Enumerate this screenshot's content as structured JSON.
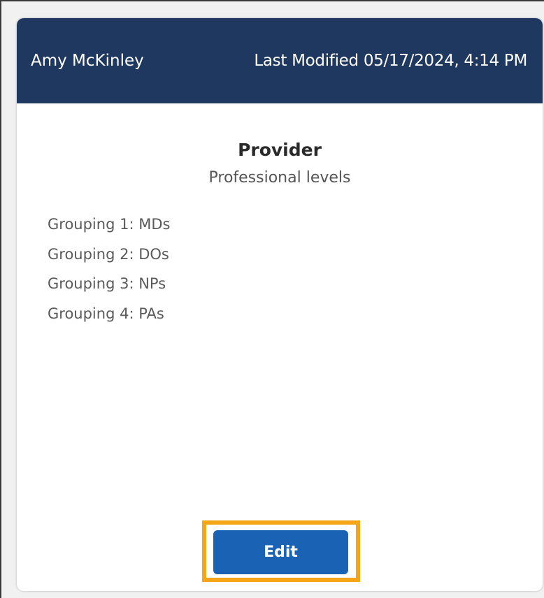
{
  "header": {
    "owner_name": "Amy McKinley",
    "last_modified": "Last Modified 05/17/2024, 4:14 PM",
    "background_color": "#1f385f"
  },
  "card": {
    "title": "Provider",
    "subtitle": "Professional levels",
    "groupings": [
      "Grouping 1: MDs",
      "Grouping 2: DOs",
      "Grouping 3: NPs",
      "Grouping 4: PAs"
    ]
  },
  "actions": {
    "edit_label": "Edit",
    "edit_color": "#1a63b4",
    "highlight_color": "#f5a516"
  }
}
